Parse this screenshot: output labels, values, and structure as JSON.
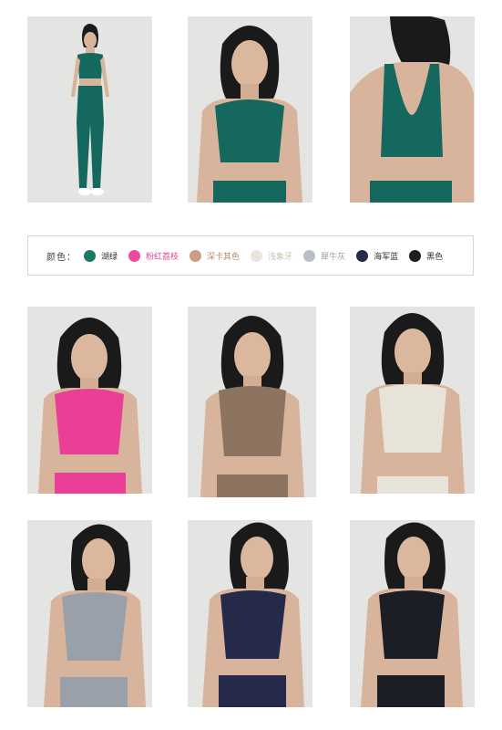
{
  "color_selector": {
    "label": "颜色：",
    "options": [
      {
        "name": "湖绿",
        "color": "#1d7668",
        "text_color": "#333333"
      },
      {
        "name": "粉红荔枝",
        "color": "#f04a9f",
        "text_color": "#e8458f"
      },
      {
        "name": "深卡其色",
        "color": "#c89e84",
        "text_color": "#b48a6c"
      },
      {
        "name": "浅象牙",
        "color": "#ebe6dc",
        "text_color": "#c8c0b0"
      },
      {
        "name": "犀牛灰",
        "color": "#b9bdc6",
        "text_color": "#9a9ea8"
      },
      {
        "name": "海军蓝",
        "color": "#262a44",
        "text_color": "#333333"
      },
      {
        "name": "黑色",
        "color": "#1e1e22",
        "text_color": "#333333"
      }
    ]
  },
  "product_photos": [
    {
      "color_name": "湖绿",
      "view": "full-body",
      "top_color": "#15685e"
    },
    {
      "color_name": "湖绿",
      "view": "front",
      "top_color": "#15685e"
    },
    {
      "color_name": "湖绿",
      "view": "back",
      "top_color": "#15685e"
    },
    {
      "color_name": "粉红荔枝",
      "view": "front",
      "top_color": "#ea3f97"
    },
    {
      "color_name": "深卡其色",
      "view": "front",
      "top_color": "#8d7460"
    },
    {
      "color_name": "浅象牙",
      "view": "front",
      "top_color": "#e8e3d8"
    },
    {
      "color_name": "犀牛灰",
      "view": "front",
      "top_color": "#9aa0aa"
    },
    {
      "color_name": "海军蓝",
      "view": "front",
      "top_color": "#252a4a"
    },
    {
      "color_name": "黑色",
      "view": "front",
      "top_color": "#1c1e26"
    }
  ]
}
